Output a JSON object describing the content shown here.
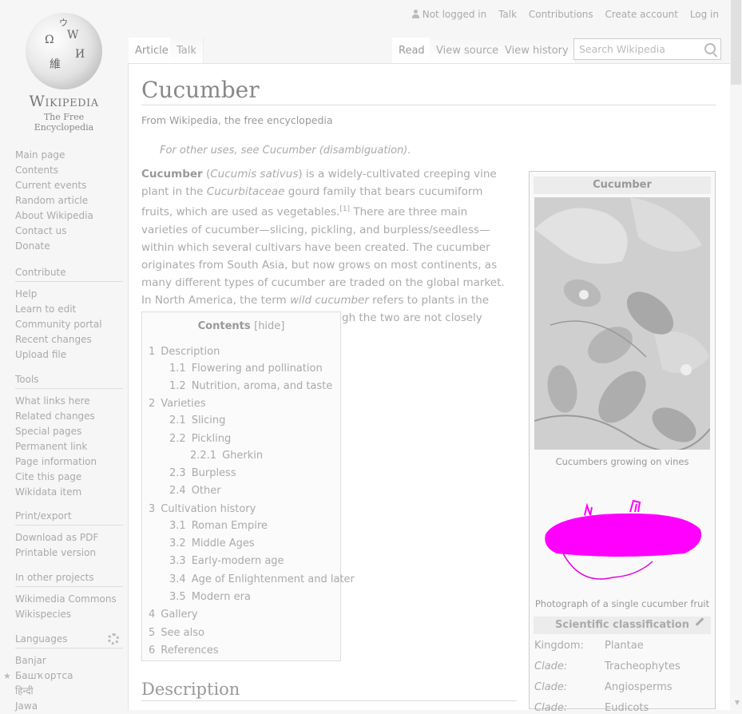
{
  "logo": {
    "wordmark": "Wikipedia",
    "tagline": "The Free Encyclopedia"
  },
  "nav_main": [
    "Main page",
    "Contents",
    "Current events",
    "Random article",
    "About Wikipedia",
    "Contact us",
    "Donate"
  ],
  "contribute": {
    "head": "Contribute",
    "items": [
      "Help",
      "Learn to edit",
      "Community portal",
      "Recent changes",
      "Upload file"
    ]
  },
  "tools": {
    "head": "Tools",
    "items": [
      "What links here",
      "Related changes",
      "Special pages",
      "Permanent link",
      "Page information",
      "Cite this page",
      "Wikidata item"
    ]
  },
  "print_export": {
    "head": "Print/export",
    "items": [
      "Download as PDF",
      "Printable version"
    ]
  },
  "other_projects": {
    "head": "In other projects",
    "items": [
      "Wikimedia Commons",
      "Wikispecies"
    ]
  },
  "languages": {
    "head": "Languages",
    "items": [
      "Banjar",
      "Башҡортса",
      "हिन्दी",
      "Jawa"
    ]
  },
  "personal": {
    "not_logged_in": "Not logged in",
    "talk": "Talk",
    "contributions": "Contributions",
    "create_account": "Create account",
    "log_in": "Log in"
  },
  "tabs": {
    "article": "Article",
    "talk": "Talk",
    "read": "Read",
    "view_source": "View source",
    "view_history": "View history"
  },
  "search": {
    "placeholder": "Search Wikipedia"
  },
  "article": {
    "title": "Cucumber",
    "from": "From Wikipedia, the free encyclopedia",
    "hatnote": "For other uses, see Cucumber (disambiguation).",
    "section_heading": "Description"
  },
  "toc": {
    "title": "Contents",
    "hide": "[hide]",
    "entries": [
      {
        "num": "1",
        "label": "Description"
      },
      {
        "num": "1.1",
        "label": "Flowering and pollination"
      },
      {
        "num": "1.2",
        "label": "Nutrition, aroma, and taste"
      },
      {
        "num": "2",
        "label": "Varieties"
      },
      {
        "num": "2.1",
        "label": "Slicing"
      },
      {
        "num": "2.2",
        "label": "Pickling"
      },
      {
        "num": "2.2.1",
        "label": "Gherkin"
      },
      {
        "num": "2.3",
        "label": "Burpless"
      },
      {
        "num": "2.4",
        "label": "Other"
      },
      {
        "num": "3",
        "label": "Cultivation history"
      },
      {
        "num": "3.1",
        "label": "Roman Empire"
      },
      {
        "num": "3.2",
        "label": "Middle Ages"
      },
      {
        "num": "3.3",
        "label": "Early-modern age"
      },
      {
        "num": "3.4",
        "label": "Age of Enlightenment and later"
      },
      {
        "num": "3.5",
        "label": "Modern era"
      },
      {
        "num": "4",
        "label": "Gallery"
      },
      {
        "num": "5",
        "label": "See also"
      },
      {
        "num": "6",
        "label": "References"
      }
    ]
  },
  "infobox": {
    "title": "Cucumber",
    "caption1": "Cucumbers growing on vines",
    "caption2": "Photograph of a single cucumber fruit",
    "sci_heading": "Scientific classification",
    "rows": [
      {
        "k": "Kingdom:",
        "v": "Plantae"
      },
      {
        "k": "Clade:",
        "v": "Tracheophytes"
      },
      {
        "k": "Clade:",
        "v": "Angiosperms"
      },
      {
        "k": "Clade:",
        "v": "Eudicots"
      }
    ]
  },
  "colors": {
    "accent_drawing": "#ff00ff"
  }
}
